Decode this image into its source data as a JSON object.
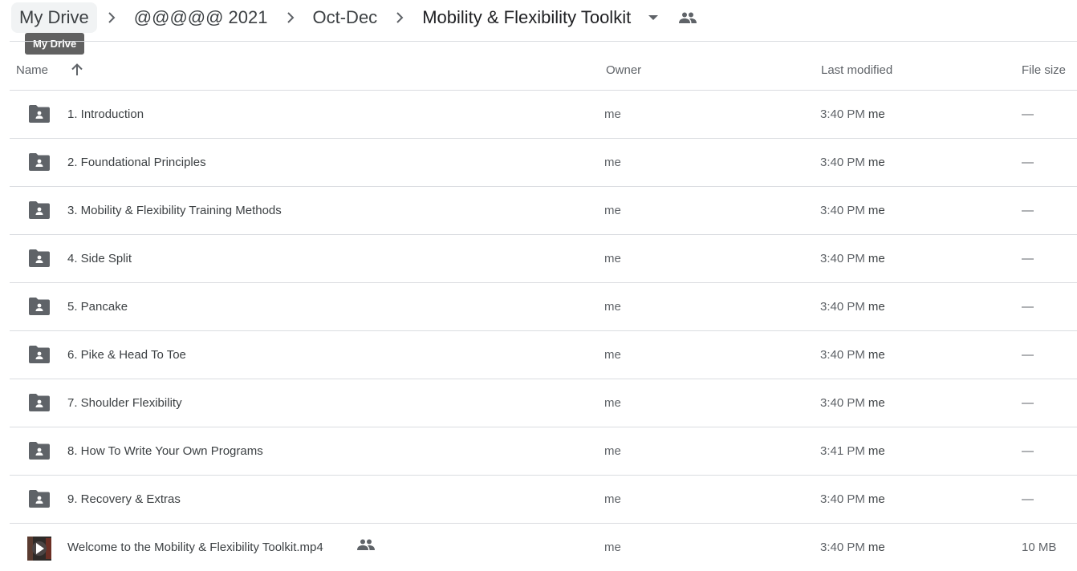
{
  "breadcrumb": {
    "items": [
      "My Drive",
      "@@@@@ 2021",
      "Oct-Dec",
      "Mobility & Flexibility Toolkit"
    ],
    "tooltip": "My Drive"
  },
  "columns": {
    "name": "Name",
    "owner": "Owner",
    "last_modified": "Last modified",
    "file_size": "File size"
  },
  "colors": {
    "icon": "#5f6368",
    "divider": "#dadce0",
    "tooltip_bg": "#616161"
  },
  "files": [
    {
      "name": "1. Introduction",
      "type": "shared-folder",
      "owner": "me",
      "modified": "3:40 PM",
      "modified_by": "me",
      "size": "—"
    },
    {
      "name": "2. Foundational Principles",
      "type": "shared-folder",
      "owner": "me",
      "modified": "3:40 PM",
      "modified_by": "me",
      "size": "—"
    },
    {
      "name": "3. Mobility & Flexibility Training Methods",
      "type": "shared-folder",
      "owner": "me",
      "modified": "3:40 PM",
      "modified_by": "me",
      "size": "—"
    },
    {
      "name": "4. Side Split",
      "type": "shared-folder",
      "owner": "me",
      "modified": "3:40 PM",
      "modified_by": "me",
      "size": "—"
    },
    {
      "name": "5. Pancake",
      "type": "shared-folder",
      "owner": "me",
      "modified": "3:40 PM",
      "modified_by": "me",
      "size": "—"
    },
    {
      "name": "6. Pike & Head To Toe",
      "type": "shared-folder",
      "owner": "me",
      "modified": "3:40 PM",
      "modified_by": "me",
      "size": "—"
    },
    {
      "name": "7. Shoulder Flexibility",
      "type": "shared-folder",
      "owner": "me",
      "modified": "3:40 PM",
      "modified_by": "me",
      "size": "—"
    },
    {
      "name": "8. How To Write Your Own Programs",
      "type": "shared-folder",
      "owner": "me",
      "modified": "3:41 PM",
      "modified_by": "me",
      "size": "—"
    },
    {
      "name": "9. Recovery & Extras",
      "type": "shared-folder",
      "owner": "me",
      "modified": "3:40 PM",
      "modified_by": "me",
      "size": "—"
    },
    {
      "name": "Welcome to the Mobility & Flexibility Toolkit.mp4",
      "type": "video",
      "shared": true,
      "owner": "me",
      "modified": "3:40 PM",
      "modified_by": "me",
      "size": "10 MB"
    }
  ]
}
